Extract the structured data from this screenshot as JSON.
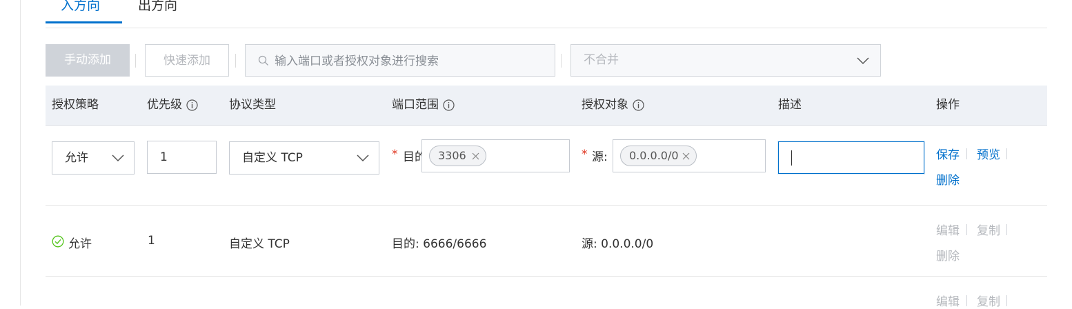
{
  "tabs": {
    "inbound": "入方向",
    "outbound": "出方向"
  },
  "toolbar": {
    "manual_add": "手动添加",
    "quick_add": "快速添加",
    "search_placeholder": "输入端口或者授权对象进行搜索",
    "merge_value": "不合并"
  },
  "table": {
    "headers": {
      "policy": "授权策略",
      "priority": "优先级",
      "protocol": "协议类型",
      "port_range": "端口范围",
      "auth_object": "授权对象",
      "description": "描述",
      "actions": "操作"
    },
    "edit_row": {
      "policy": "允许",
      "priority": "1",
      "protocol": "自定义 TCP",
      "port_label": "目的",
      "port_tag": "3306",
      "source_label": "源:",
      "source_tag": "0.0.0.0/0",
      "description": "",
      "actions": {
        "save": "保存",
        "preview": "预览",
        "delete": "删除"
      }
    },
    "rows": [
      {
        "policy": "允许",
        "priority": "1",
        "protocol": "自定义 TCP",
        "port": "目的: 6666/6666",
        "source": "源: 0.0.0.0/0",
        "actions": {
          "edit": "编辑",
          "copy": "复制",
          "delete": "删除"
        }
      },
      {
        "actions": {
          "edit": "编辑",
          "copy": "复制"
        }
      }
    ]
  },
  "colors": {
    "accent": "#0070cc",
    "required": "#e0341f",
    "success": "#52c41a",
    "disabled": "#b5b8bd"
  }
}
